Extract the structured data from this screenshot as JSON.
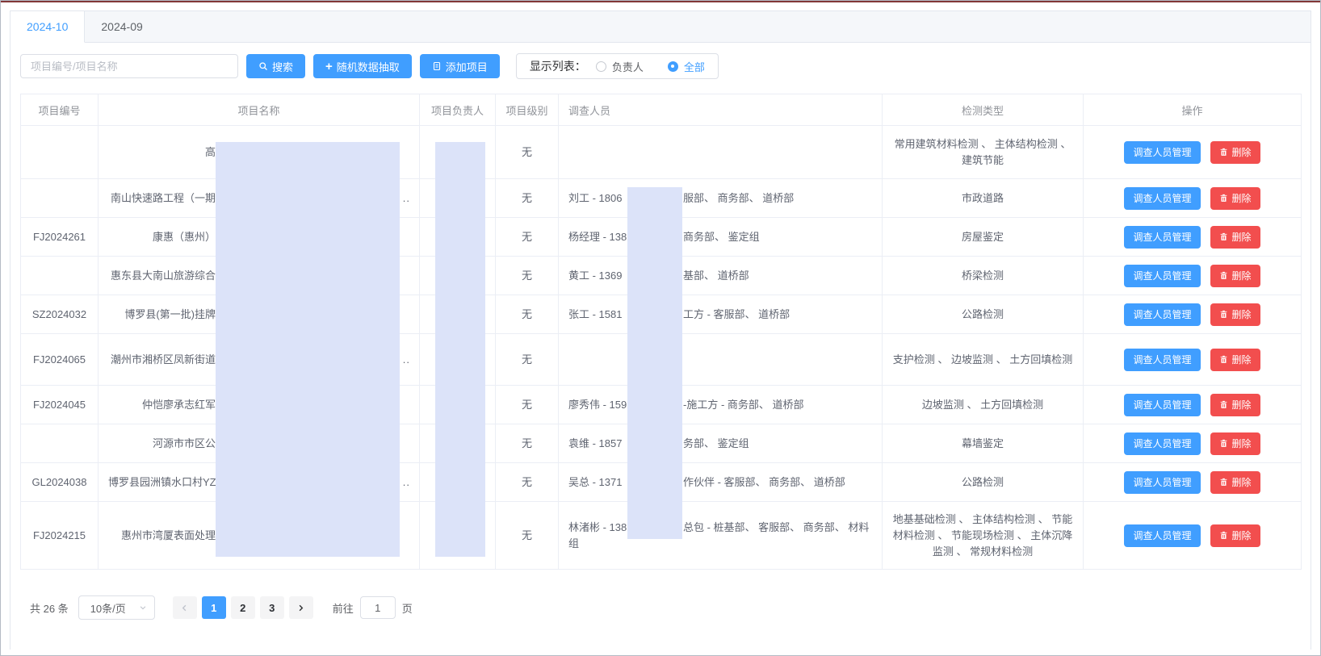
{
  "tabs": [
    {
      "label": "2024-10",
      "active": true
    },
    {
      "label": "2024-09",
      "active": false
    }
  ],
  "toolbar": {
    "search_placeholder": "项目编号/项目名称",
    "search_button": "搜索",
    "random_button": "随机数据抽取",
    "add_button": "添加项目",
    "display_label": "显示列表：",
    "radio_options": [
      {
        "label": "负责人",
        "checked": false
      },
      {
        "label": "全部",
        "checked": true
      }
    ]
  },
  "table": {
    "headers": [
      "项目编号",
      "项目名称",
      "项目负责人",
      "项目级别",
      "调查人员",
      "检测类型",
      "操作"
    ],
    "manage_button": "调查人员管理",
    "delete_button": "删除",
    "icons": {
      "delete": "trash-icon",
      "search": "search-icon",
      "add": "document-icon",
      "random": "plus-icon"
    },
    "rows": [
      {
        "code": "",
        "name": "高",
        "name_truncated": false,
        "leader": "",
        "level": "无",
        "inv_left": "",
        "inv_right": "",
        "type": "常用建筑材料检测 、 主体结构检测 、 建筑节能"
      },
      {
        "code": "",
        "name": "南山快速路工程（一期",
        "name_truncated": true,
        "leader": "",
        "level": "无",
        "inv_left": "刘工 - 1806",
        "inv_right": "服部、 商务部、 道桥部",
        "type": "市政道路"
      },
      {
        "code": "FJ2024261",
        "name": "康惠（惠州）",
        "name_truncated": false,
        "leader": "",
        "level": "无",
        "inv_left": "杨经理 - 138",
        "inv_right": "商务部、 鉴定组",
        "type": "房屋鉴定"
      },
      {
        "code": "",
        "name": "惠东县大南山旅游综合",
        "name_truncated": false,
        "leader": "",
        "level": "无",
        "inv_left": "黄工 - 1369",
        "inv_right": "基部、 道桥部",
        "type": "桥梁检测"
      },
      {
        "code": "SZ2024032",
        "name": "博罗县(第一批)挂牌",
        "name_truncated": false,
        "leader": "",
        "level": "无",
        "inv_left": "张工 - 1581",
        "inv_right": "工方 - 客服部、 道桥部",
        "type": "公路检测"
      },
      {
        "code": "FJ2024065",
        "name": "潮州市湘桥区凤新街道",
        "name_truncated": true,
        "leader": "",
        "level": "无",
        "inv_left": "",
        "inv_right": "",
        "type": "支护检测 、 边坡监测 、 土方回填检测"
      },
      {
        "code": "FJ2024045",
        "name": "仲恺廖承志红军",
        "name_truncated": false,
        "leader": "",
        "level": "无",
        "inv_left": "廖秀伟 - 159",
        "inv_right": "-施工方 - 商务部、 道桥部",
        "type": "边坡监测 、 土方回填检测"
      },
      {
        "code": "",
        "name": "河源市市区公",
        "name_truncated": false,
        "leader": "",
        "level": "无",
        "inv_left": "袁维 - 1857",
        "inv_right": "务部、 鉴定组",
        "type": "幕墙鉴定"
      },
      {
        "code": "GL2024038",
        "name": "博罗县园洲镇水口村YZ",
        "name_truncated": true,
        "leader": "",
        "level": "无",
        "inv_left": "吴总 - 1371",
        "inv_right": "作伙伴 - 客服部、 商务部、 道桥部",
        "type": "公路检测"
      },
      {
        "code": "FJ2024215",
        "name": "惠州市湾厦表面处理",
        "name_truncated": false,
        "leader": "",
        "level": "无",
        "inv_left": "林渚彬 - 138",
        "inv_right": "总包 - 桩基部、 客服部、 商务部、 材料组",
        "type": "地基基础检测 、 主体结构检测 、 节能材料检测 、 节能现场检测 、 主体沉降监测 、 常规材料检测"
      }
    ]
  },
  "pagination": {
    "total_text": "共 26 条",
    "page_size": "10条/页",
    "pages": [
      "1",
      "2",
      "3"
    ],
    "active_page": "1",
    "goto_label": "前往",
    "goto_value": "1",
    "goto_suffix": "页"
  },
  "colors": {
    "primary": "#409eff",
    "danger": "#f24e4e",
    "redaction": "#dce3f9",
    "top_accent": "#823737"
  }
}
